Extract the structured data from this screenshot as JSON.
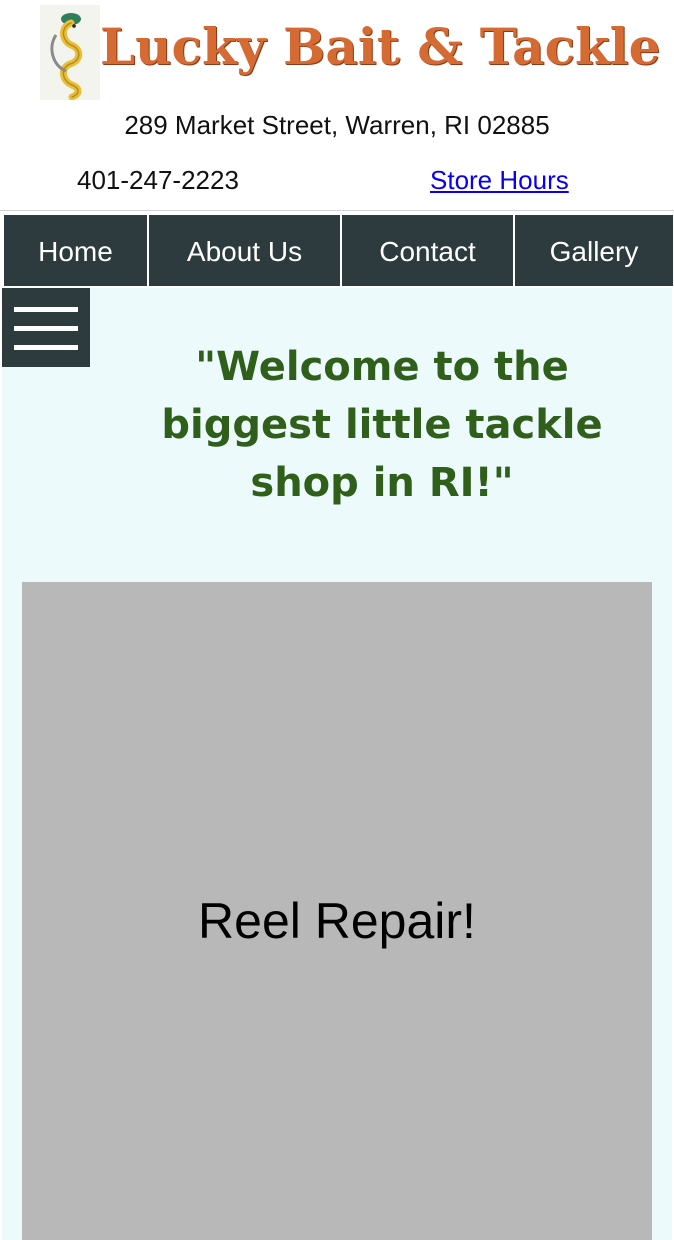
{
  "header": {
    "logo_text": "Lucky Bait & Tackle",
    "address": "289 Market Street, Warren, RI 02885",
    "phone": "401-247-2223",
    "hours_link": "Store Hours"
  },
  "nav": {
    "items": [
      {
        "label": "Home"
      },
      {
        "label": "About Us"
      },
      {
        "label": "Contact"
      },
      {
        "label": "Gallery"
      }
    ]
  },
  "main": {
    "welcome": "\"Welcome to the biggest little tackle shop in RI!\"",
    "promo": "Reel Repair!"
  },
  "colors": {
    "logo_orange": "#d56a33",
    "nav_bg": "#2e3b3e",
    "content_bg": "#edfafc",
    "welcome_green": "#2f5f1a",
    "promo_gray": "#b8b8b8",
    "link_blue": "#0a00ee"
  },
  "icons": {
    "logo": "worm-hook-logo-icon",
    "menu": "hamburger-menu-icon"
  }
}
